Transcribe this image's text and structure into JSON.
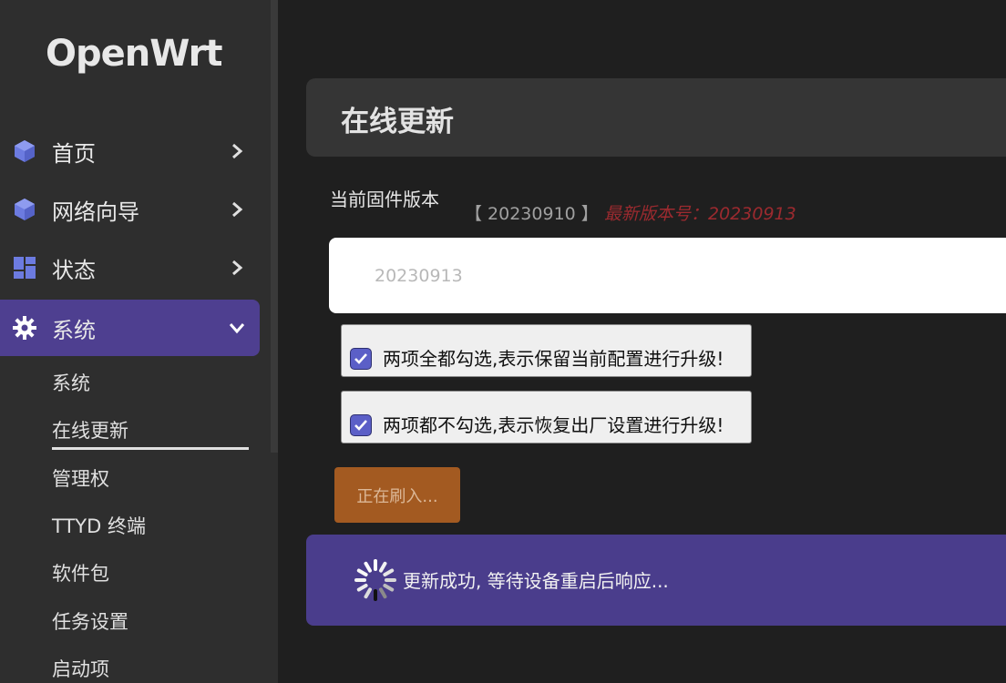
{
  "brand": {
    "logo": "OpenWrt"
  },
  "sidebar": {
    "items": [
      {
        "label": "首页",
        "icon": "cube-icon"
      },
      {
        "label": "网络向导",
        "icon": "cube-icon"
      },
      {
        "label": "状态",
        "icon": "dashboard-icon"
      },
      {
        "label": "系统",
        "icon": "gear-icon",
        "active": true
      }
    ],
    "sub_items": [
      {
        "label": "系统"
      },
      {
        "label": "在线更新",
        "active": true
      },
      {
        "label": "管理权"
      },
      {
        "label": "TTYD 终端"
      },
      {
        "label": "软件包"
      },
      {
        "label": "任务设置"
      },
      {
        "label": "启动项"
      }
    ]
  },
  "page": {
    "title": "在线更新"
  },
  "firmware": {
    "label": "当前固件版本",
    "current": "【 20230910 】",
    "latest": "最新版本号：20230913",
    "input_placeholder": "20230913"
  },
  "options": [
    {
      "label": "两项全都勾选,表示保留当前配置进行升级!",
      "checked": true
    },
    {
      "label": "两项都不勾选,表示恢复出厂设置进行升级!",
      "checked": true
    }
  ],
  "flash_button": {
    "label": "正在刷入..."
  },
  "status": {
    "text": "更新成功, 等待设备重启后响应..."
  },
  "colors": {
    "accent": "#4e3f90",
    "status_bg": "#4a3d8c",
    "flash_btn": "#a35a21",
    "latest_text": "#9c2a2f",
    "checkbox": "#5b5fc7"
  }
}
